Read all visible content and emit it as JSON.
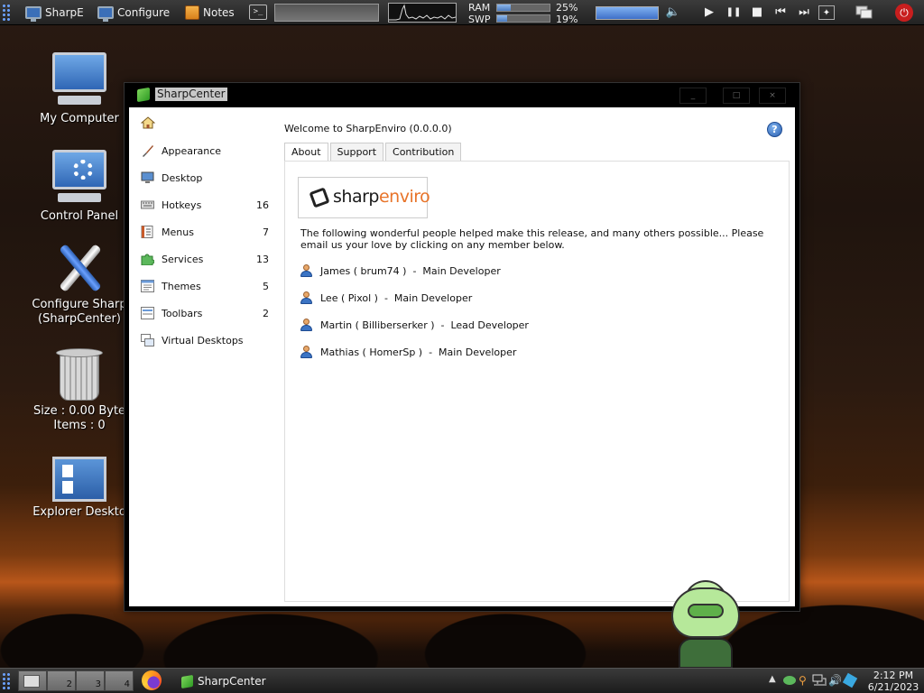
{
  "topbar": {
    "items": [
      {
        "label": "SharpE",
        "icon": "monitor-icon"
      },
      {
        "label": "Configure",
        "icon": "monitor-icon"
      },
      {
        "label": "Notes",
        "icon": "notes-icon"
      }
    ],
    "terminal_glyph": ">_",
    "ram_label": "RAM",
    "ram_pct": "25%",
    "ram_value": 0.25,
    "swp_label": "SWP",
    "swp_pct": "19%",
    "swp_value": 0.19,
    "volume_value": 1.0,
    "media": {
      "play": "▶",
      "pause": "❚❚",
      "stop": "■",
      "prev": "⏮",
      "next": "⏭"
    },
    "power_glyph": "⏻"
  },
  "desktop_icons": [
    {
      "label": "My Computer"
    },
    {
      "label": "Control Panel"
    },
    {
      "label": "Configure Sharp (SharpCenter)",
      "line1": "Configure Sharp",
      "line2": "(SharpCenter)"
    },
    {
      "label": "Size : 0.00 Byte Items : 0",
      "line1": "Size : 0.00 Byte",
      "line2": "Items : 0"
    },
    {
      "label": "Explorer Deskto"
    }
  ],
  "window": {
    "title": "SharpCenter",
    "minimize": "_",
    "maximize": "□",
    "close": "×",
    "sidebar": {
      "home_icon": "home-icon",
      "items": [
        {
          "label": "Appearance",
          "count": "",
          "icon": "brush-icon"
        },
        {
          "label": "Desktop",
          "count": "",
          "icon": "monitor-icon"
        },
        {
          "label": "Hotkeys",
          "count": "16",
          "icon": "keyboard-icon"
        },
        {
          "label": "Menus",
          "count": "7",
          "icon": "menu-icon"
        },
        {
          "label": "Services",
          "count": "13",
          "icon": "puzzle-icon"
        },
        {
          "label": "Themes",
          "count": "5",
          "icon": "themes-icon"
        },
        {
          "label": "Toolbars",
          "count": "2",
          "icon": "toolbar-icon"
        },
        {
          "label": "Virtual Desktops",
          "count": "",
          "icon": "virtual-desktops-icon"
        }
      ]
    },
    "main": {
      "welcome": "Welcome to SharpEnviro (0.0.0.0)",
      "help_glyph": "?",
      "tabs": [
        {
          "label": "About",
          "active": true
        },
        {
          "label": "Support",
          "active": false
        },
        {
          "label": "Contribution",
          "active": false
        }
      ],
      "logo": {
        "part1": "sharp",
        "part2": "enviro"
      },
      "intro": "The following wonderful people helped make this release, and many others possible... Please email us your love by clicking on any member below.",
      "members": [
        {
          "label": "James ( brum74 )  -  Main Developer"
        },
        {
          "label": "Lee ( Pixol )  -  Main Developer"
        },
        {
          "label": "Martin ( Billiberserker )  -  Lead Developer"
        },
        {
          "label": "Mathias ( HomerSp )  -  Main Developer"
        }
      ]
    }
  },
  "taskbar": {
    "workspaces": [
      "",
      "2",
      "3",
      "4"
    ],
    "task_label": "SharpCenter",
    "clock_time": "2:12 PM",
    "clock_date": "6/21/2023"
  },
  "colors": {
    "accent": "#3b74c4",
    "logo_orange": "#e8742a",
    "power": "#c81e1e"
  }
}
